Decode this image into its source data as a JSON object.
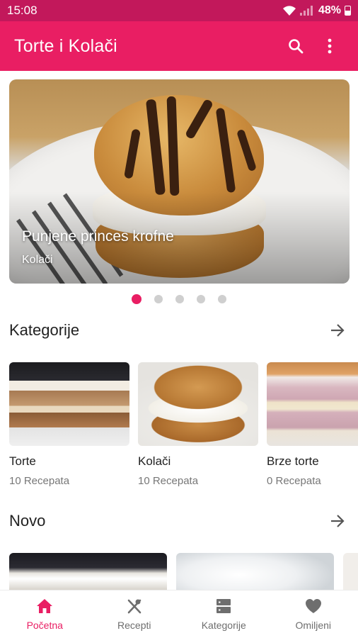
{
  "status_bar": {
    "time": "15:08",
    "battery": "48%"
  },
  "app_bar": {
    "title": "Torte i Kolači",
    "search_icon": "search-icon",
    "menu_icon": "more-vert-icon"
  },
  "hero": {
    "title": "Punjene princes krofne",
    "subtitle": "Kolači"
  },
  "carousel": {
    "page_count": 5,
    "active_index": 0
  },
  "categories_section": {
    "title": "Kategorije",
    "items": [
      {
        "name": "Torte",
        "count": "10 Recepata"
      },
      {
        "name": "Kolači",
        "count": "10 Recepata"
      },
      {
        "name": "Brze torte",
        "count": "0 Recepata"
      }
    ]
  },
  "novo_section": {
    "title": "Novo"
  },
  "bottom_nav": {
    "items": [
      {
        "label": "Početna",
        "icon": "home-icon"
      },
      {
        "label": "Recepti",
        "icon": "utensils-icon"
      },
      {
        "label": "Kategorije",
        "icon": "categories-icon"
      },
      {
        "label": "Omiljeni",
        "icon": "heart-icon"
      }
    ],
    "active_index": 0
  },
  "colors": {
    "primary": "#e91e63",
    "status_bar": "#c2185b",
    "inactive": "#6e6e6e"
  }
}
